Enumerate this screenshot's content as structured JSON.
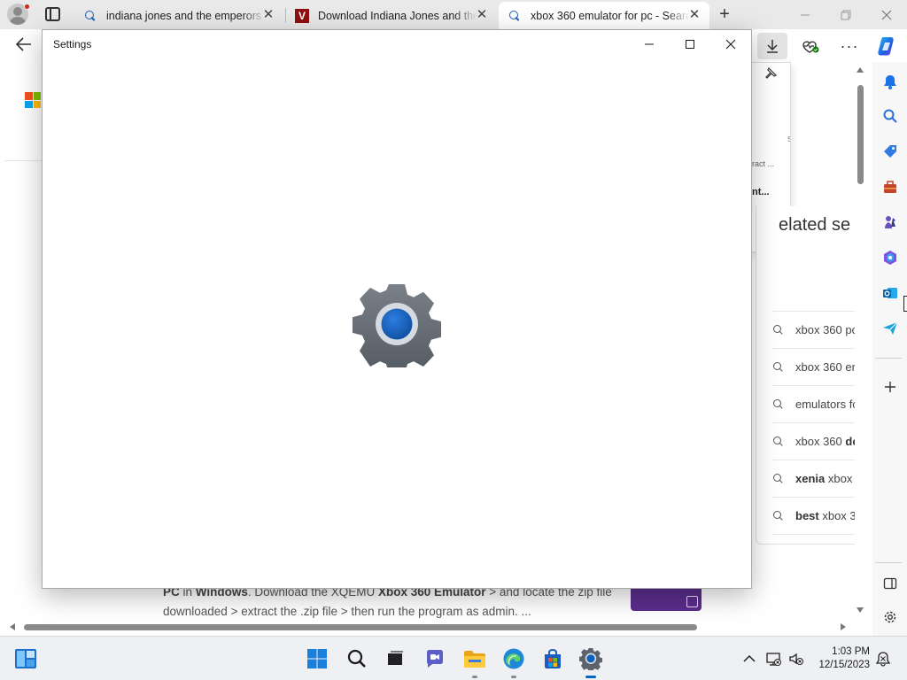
{
  "browser": {
    "tabs": [
      {
        "title": "indiana jones and the emperors",
        "icon": "search-icon",
        "active": false
      },
      {
        "title": "Download Indiana Jones and the",
        "icon": "v-site-icon",
        "active": false
      },
      {
        "title": "xbox 360 emulator for pc - Search",
        "icon": "search-icon",
        "active": true
      }
    ],
    "new_tab": "+",
    "toolbar": {
      "download_icon": "download-icon",
      "performance_icon": "heartbeat-icon",
      "more_label": "···"
    }
  },
  "page": {
    "snippet_line1_parts": [
      "PC",
      " in ",
      "Windows",
      ". Download the XQEMU ",
      "Xbox 360 Emulator",
      " > and locate the zip file"
    ],
    "snippet_line2": "downloaded > extract the .zip file > then run the program as admin. ...",
    "downloads_flyout": {
      "text_small": "ract ...",
      "text_bold": "nt...",
      "text_faded": "s"
    },
    "related": {
      "title": "elated se",
      "items": [
        {
          "text": "xbox 360 pc",
          "bold": ""
        },
        {
          "text": "xbox 360 er",
          "bold": ""
        },
        {
          "text": "emulators fo",
          "bold": ""
        },
        {
          "text": "xbox 360 ",
          "bold": "do"
        },
        {
          "text": " xbox 3",
          "bold": "xenia",
          "bold_first": true
        },
        {
          "text": " xbox 3",
          "bold": "best",
          "bold_first": true
        },
        {
          "text": " xbox 3",
          "bold": "best",
          "bold_first": true
        },
        {
          "text": "xbox 360 er",
          "bold": ""
        }
      ]
    }
  },
  "settings_window": {
    "title": "Settings",
    "minimize": "—",
    "maximize": "☐",
    "close": "✕"
  },
  "taskbar": {
    "time": "1:03 PM",
    "date": "12/15/2023"
  },
  "colors": {
    "accent": "#0067c0",
    "gear_blue": "#1160b8",
    "purple": "#5b2d8c"
  }
}
